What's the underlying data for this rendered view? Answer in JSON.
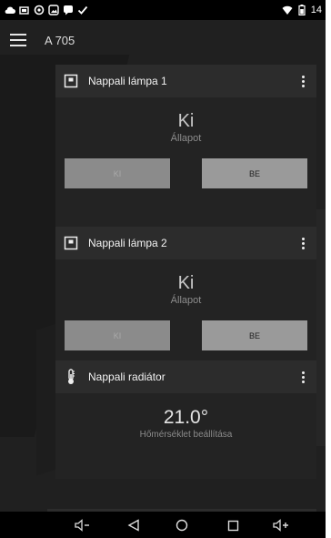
{
  "app": {
    "title": "A 705"
  },
  "status_bar": {
    "time": "14",
    "left_icons": [
      "cloud-icon",
      "phone-screen-icon",
      "sync-circle-icon",
      "image-icon",
      "message-icon",
      "check-icon"
    ],
    "right_icons": [
      "wifi-icon",
      "battery-icon"
    ]
  },
  "cards": [
    {
      "title": "Nappali lámpa 1",
      "icon": "light-switch-icon",
      "state_value": "Ki",
      "state_label": "Állapot",
      "off_label": "KI",
      "on_label": "BE"
    },
    {
      "title": "Nappali lámpa 2",
      "icon": "light-switch-icon",
      "state_value": "Ki",
      "state_label": "Állapot",
      "off_label": "KI",
      "on_label": "BE"
    },
    {
      "title": "Nappali radiátor",
      "icon": "thermometer-icon",
      "temperature": "21.0°",
      "temperature_label": "Hőmérséklet beállítása"
    }
  ],
  "nav_bar": {
    "buttons": [
      "volume-down-icon",
      "back-icon",
      "home-icon",
      "recents-icon",
      "volume-up-icon"
    ]
  },
  "colors": {
    "background": "#202020",
    "card_header": "#2c2c2c",
    "card_body": "#232323",
    "button_gray": "#9a9a9a",
    "status_bar": "#000000"
  }
}
